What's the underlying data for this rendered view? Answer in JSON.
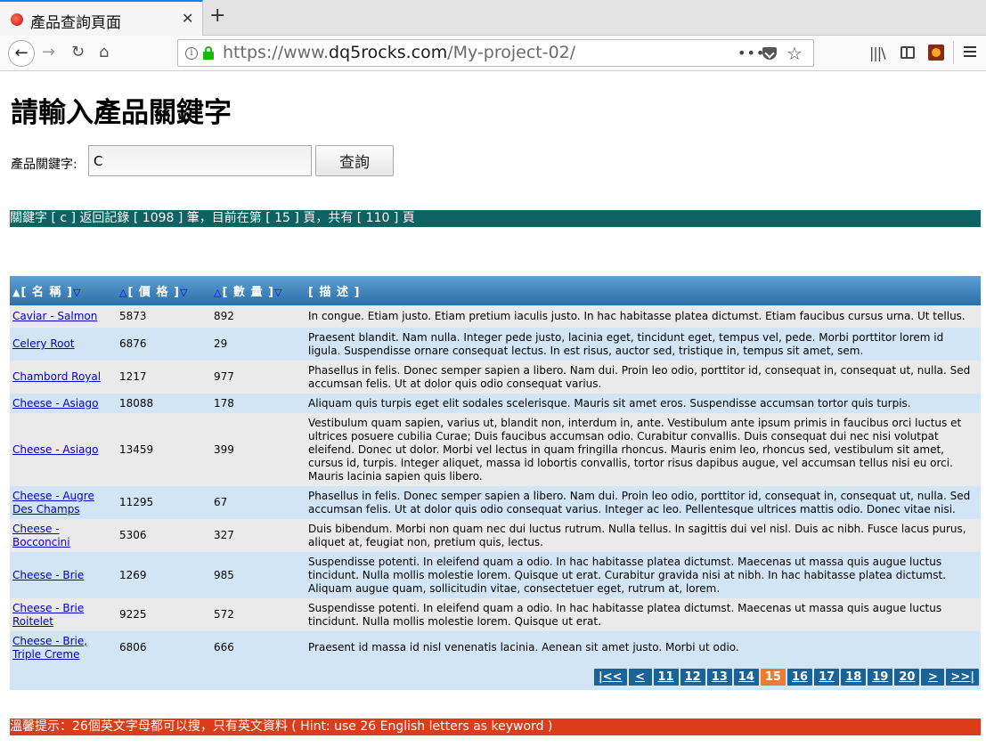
{
  "browser": {
    "tab_title": "產品查詢頁面",
    "tab_close": "✕",
    "new_tab": "+",
    "url_scheme": "https://www.",
    "url_host": "dq5rocks.com",
    "url_path": "/My-project-02/",
    "url_more": "•••",
    "icons": [
      "back-icon",
      "forward-icon",
      "reload-icon",
      "home-icon",
      "site-info-icon",
      "lock-icon",
      "pocket-icon",
      "bookmark-star-icon",
      "library-icon",
      "sidebar-icon",
      "extension-icon",
      "menu-icon"
    ],
    "accent": "#0a84ff"
  },
  "page": {
    "heading": "請輸入產品關鍵字",
    "search": {
      "label": "產品關鍵字:",
      "value": "C",
      "button_label": "查詢"
    },
    "status_text": "關鍵字 [ c ] 返回記錄 [ 1098 ] 筆，目前在第 [ 15 ] 頁，共有 [ 110 ] 頁",
    "status_color": "#0e6262",
    "table": {
      "columns": [
        {
          "label": "[ 名 稱 ]",
          "up": "▲",
          "down": "▽"
        },
        {
          "label": "[ 價 格 ]",
          "up": "△",
          "down": "▽"
        },
        {
          "label": "[ 數 量 ]",
          "up": "△",
          "down": "▽"
        },
        {
          "label": "[ 描 述 ]"
        }
      ],
      "rows": [
        {
          "name": "Caviar - Salmon",
          "price": "5873",
          "qty": "892",
          "desc": "In congue. Etiam justo. Etiam pretium iaculis justo. In hac habitasse platea dictumst. Etiam faucibus cursus urna. Ut tellus."
        },
        {
          "name": "Celery Root",
          "price": "6876",
          "qty": "29",
          "desc": "Praesent blandit. Nam nulla. Integer pede justo, lacinia eget, tincidunt eget, tempus vel, pede. Morbi porttitor lorem id ligula. Suspendisse ornare consequat lectus. In est risus, auctor sed, tristique in, tempus sit amet, sem."
        },
        {
          "name": "Chambord Royal",
          "price": "1217",
          "qty": "977",
          "desc": "Phasellus in felis. Donec semper sapien a libero. Nam dui. Proin leo odio, porttitor id, consequat in, consequat ut, nulla. Sed accumsan felis. Ut at dolor quis odio consequat varius."
        },
        {
          "name": "Cheese - Asiago",
          "price": "18088",
          "qty": "178",
          "desc": "Aliquam quis turpis eget elit sodales scelerisque. Mauris sit amet eros. Suspendisse accumsan tortor quis turpis."
        },
        {
          "name": "Cheese - Asiago",
          "price": "13459",
          "qty": "399",
          "desc": "Vestibulum quam sapien, varius ut, blandit non, interdum in, ante. Vestibulum ante ipsum primis in faucibus orci luctus et ultrices posuere cubilia Curae; Duis faucibus accumsan odio. Curabitur convallis. Duis consequat dui nec nisi volutpat eleifend. Donec ut dolor. Morbi vel lectus in quam fringilla rhoncus. Mauris enim leo, rhoncus sed, vestibulum sit amet, cursus id, turpis. Integer aliquet, massa id lobortis convallis, tortor risus dapibus augue, vel accumsan tellus nisi eu orci. Mauris lacinia sapien quis libero."
        },
        {
          "name": "Cheese - Augre Des Champs",
          "price": "11295",
          "qty": "67",
          "desc": "Phasellus in felis. Donec semper sapien a libero. Nam dui. Proin leo odio, porttitor id, consequat in, consequat ut, nulla. Sed accumsan felis. Ut at dolor quis odio consequat varius. Integer ac leo. Pellentesque ultrices mattis odio. Donec vitae nisi."
        },
        {
          "name": "Cheese - Bocconcini",
          "price": "5306",
          "qty": "327",
          "desc": "Duis bibendum. Morbi non quam nec dui luctus rutrum. Nulla tellus. In sagittis dui vel nisl. Duis ac nibh. Fusce lacus purus, aliquet at, feugiat non, pretium quis, lectus."
        },
        {
          "name": "Cheese - Brie",
          "price": "1269",
          "qty": "985",
          "desc": "Suspendisse potenti. In eleifend quam a odio. In hac habitasse platea dictumst. Maecenas ut massa quis augue luctus tincidunt. Nulla mollis molestie lorem. Quisque ut erat. Curabitur gravida nisi at nibh. In hac habitasse platea dictumst. Aliquam augue quam, sollicitudin vitae, consectetuer eget, rutrum at, lorem."
        },
        {
          "name": "Cheese - Brie Roitelet",
          "price": "9225",
          "qty": "572",
          "desc": "Suspendisse potenti. In eleifend quam a odio. In hac habitasse platea dictumst. Maecenas ut massa quis augue luctus tincidunt. Nulla mollis molestie lorem. Quisque ut erat."
        },
        {
          "name": "Cheese - Brie, Triple Creme",
          "price": "6806",
          "qty": "666",
          "desc": "Praesent id massa id nisl venenatis lacinia. Aenean sit amet justo. Morbi ut odio."
        }
      ]
    },
    "pager": {
      "links": [
        "|<<",
        "<",
        "11",
        "12",
        "13",
        "14",
        "15",
        "16",
        "17",
        "18",
        "19",
        "20",
        ">",
        ">>|"
      ],
      "current": "15",
      "current_color": "#f37b31",
      "link_color": "#1a6396"
    },
    "hint": "溫馨提示：26個英文字母都可以搜，只有英文資料 ( Hint: use 26 English letters as keyword )",
    "hint_color": "#dc3c1a"
  }
}
